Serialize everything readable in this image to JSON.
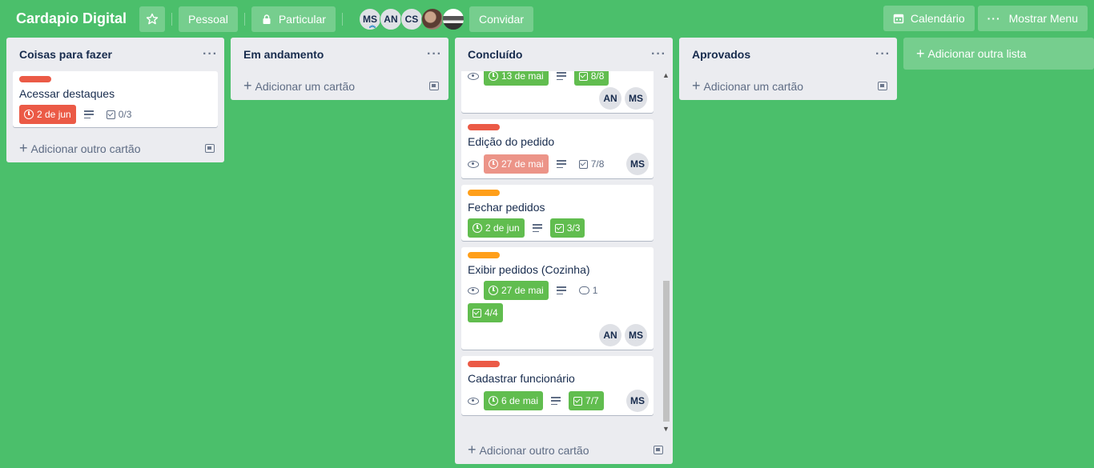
{
  "header": {
    "board_title": "Cardapio Digital",
    "team_button": "Pessoal",
    "visibility_button": "Particular",
    "invite_button": "Convidar",
    "calendar_button": "Calendário",
    "menu_button": "Mostrar Menu",
    "members": [
      "MS",
      "AN",
      "CS"
    ]
  },
  "lists": [
    {
      "title": "Coisas para fazer",
      "add_card": "Adicionar outro cartão",
      "cards": [
        {
          "label_color": "#eb5a46",
          "title": "Acessar destaques",
          "due": "2 de jun",
          "checklist": "0/3"
        }
      ]
    },
    {
      "title": "Em andamento",
      "add_card": "Adicionar um cartão",
      "cards": []
    },
    {
      "title": "Concluído",
      "add_card": "Adicionar outro cartão",
      "cards": [
        {
          "due": "13 de mai",
          "checklist": "8/8",
          "members": [
            "AN",
            "MS"
          ]
        },
        {
          "label_color": "#eb5a46",
          "title": "Edição do pedido",
          "due": "27 de mai",
          "checklist": "7/8",
          "members": [
            "MS"
          ]
        },
        {
          "label_color": "#ff9f1a",
          "title": "Fechar pedidos",
          "due": "2 de jun",
          "checklist": "3/3"
        },
        {
          "label_color": "#ff9f1a",
          "title": "Exibir pedidos (Cozinha)",
          "due": "27 de mai",
          "comments": "1",
          "checklist": "4/4",
          "members": [
            "AN",
            "MS"
          ]
        },
        {
          "label_color": "#eb5a46",
          "title": "Cadastrar funcionário",
          "due": "6 de mai",
          "checklist": "7/7",
          "members": [
            "MS"
          ]
        }
      ]
    },
    {
      "title": "Aprovados",
      "add_card": "Adicionar um cartão",
      "cards": []
    }
  ],
  "add_list": "Adicionar outra lista",
  "icons": {
    "star": "star-icon",
    "lock": "lock-icon",
    "calendar": "calendar-icon",
    "more": "more-icon",
    "watch": "eye-icon",
    "due": "clock-icon",
    "description": "description-icon",
    "checklist": "checklist-icon",
    "comment": "comment-icon",
    "template": "template-icon"
  },
  "colors": {
    "board_background": "#4bbf6b",
    "label_red": "#eb5a46",
    "label_orange": "#ff9f1a",
    "badge_green": "#61bd4f"
  }
}
